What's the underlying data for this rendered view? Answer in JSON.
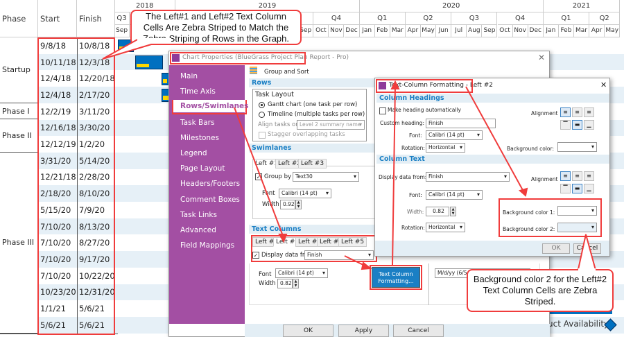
{
  "table": {
    "headers": {
      "phase": "Phase",
      "start": "Start",
      "finish": "Finish"
    },
    "rows": [
      {
        "start": "9/8/18",
        "finish": "10/8/18"
      },
      {
        "start": "10/11/18",
        "finish": "12/3/18"
      },
      {
        "start": "12/4/18",
        "finish": "12/20/18"
      },
      {
        "start": "12/4/18",
        "finish": "2/17/20"
      },
      {
        "start": "12/2/19",
        "finish": "3/11/20"
      },
      {
        "start": "12/16/18",
        "finish": "3/30/20"
      },
      {
        "start": "12/12/19",
        "finish": "1/2/20"
      },
      {
        "start": "3/31/20",
        "finish": "5/14/20"
      },
      {
        "start": "12/21/18",
        "finish": "2/28/20"
      },
      {
        "start": "2/18/20",
        "finish": "8/10/20"
      },
      {
        "start": "5/15/20",
        "finish": "7/9/20"
      },
      {
        "start": "7/10/20",
        "finish": "8/13/20"
      },
      {
        "start": "7/10/20",
        "finish": "8/27/20"
      },
      {
        "start": "7/10/20",
        "finish": "9/17/20"
      },
      {
        "start": "7/10/20",
        "finish": "10/22/20"
      },
      {
        "start": "10/23/20",
        "finish": "12/31/20"
      },
      {
        "start": "1/1/21",
        "finish": "5/6/21"
      },
      {
        "start": "5/6/21",
        "finish": "5/6/21"
      }
    ],
    "phases": [
      "Startup",
      "Phase I",
      "Phase II",
      "Phase III"
    ]
  },
  "timescale": {
    "years": [
      "2018",
      "2019",
      "2020",
      "2021"
    ],
    "quarters": [
      "Q3",
      "Q4",
      "Q1",
      "Q2",
      "Q3",
      "Q4",
      "Q1",
      "Q2",
      "Q3",
      "Q4",
      "Q1",
      "Q2"
    ],
    "months": [
      "Sep",
      "Oct",
      "Nov",
      "Dec",
      "Jan",
      "Feb",
      "Mar",
      "Apr",
      "May",
      "Jun",
      "Jul",
      "Aug",
      "Sep",
      "Oct",
      "Nov",
      "Dec",
      "Jan",
      "Feb",
      "Mar",
      "Apr",
      "May",
      "Jun",
      "Jul",
      "Aug",
      "Sep",
      "Oct",
      "Nov",
      "Dec",
      "Jan",
      "Feb",
      "Mar",
      "Apr",
      "May"
    ]
  },
  "milestone_label": "uct Availability",
  "chart_properties": {
    "title": "Chart Properties (BlueGrass Project Plan Report - Pro)",
    "sidebar": [
      "Main",
      "Time Axis",
      "Rows/Swimlanes",
      "Task Bars",
      "Milestones",
      "Legend",
      "Page Layout",
      "Headers/Footers",
      "Comment Boxes",
      "Task Links",
      "Advanced",
      "Field Mappings"
    ],
    "group_sort": "Group and Sort",
    "rows_header": "Rows",
    "task_layout": "Task Layout",
    "gantt_option": "Gantt chart (one task per row)",
    "timeline_option": "Timeline (multiple tasks per row)",
    "align_label": "Align tasks on",
    "align_value": "Level 2 summary name",
    "stagger": "Stagger overlapping tasks",
    "swimlanes_header": "Swimlanes",
    "swim_tabs": [
      "Left #1",
      "Left #2",
      "Left #3"
    ],
    "group_by": "Group by",
    "group_by_value": "Text30",
    "font_label": "Font",
    "width_label": "Width",
    "swim_font": "Calibri (14 pt)",
    "swim_width": "0.92",
    "text_columns_header": "Text Columns",
    "tc_tabs": [
      "Left #1",
      "Left #2",
      "Left #3",
      "Left #4",
      "Left #5"
    ],
    "display_from": "Display data from",
    "display_value": "Finish",
    "tc_font": "Calibri (14 pt)",
    "tc_width": "0.82",
    "tcf_button": "Text Column Formatting...",
    "date_format": "M/d/yy (6/5/3",
    "ok": "OK",
    "apply": "Apply",
    "cancel": "Cancel"
  },
  "text_col_fmt": {
    "title": "Text-Column Formatting - Left #2",
    "headings_header": "Column Headings",
    "make_heading": "Make heading automatically",
    "custom_heading_label": "Custom heading:",
    "custom_heading": "Finish",
    "font_label": "Font:",
    "font": "Calibri (14 pt)",
    "rotation_label": "Rotation:",
    "rotation": "Horizontal",
    "alignment": "Alignment",
    "bg_color": "Background color:",
    "column_text_header": "Column Text",
    "display_from_label": "Display data from:",
    "display_from": "Finish",
    "font2": "Calibri (14 pt)",
    "width_label": "Width:",
    "width": "0.82",
    "rotation2": "Horizontal",
    "bg1": "Background color 1:",
    "bg2": "Background color 2:",
    "ok": "OK",
    "cancel": "Cancel"
  },
  "callouts": {
    "top": "The Left#1 and Left#2 Text Column Cells Are Zebra Striped to Match the Zebra Striping of Rows in the Graph.",
    "bottom": "Background color 2 for the Left#2 Text Column Cells are Zebra Striped."
  },
  "colors": {
    "stripe": "#e6f0f7",
    "bar": "#0070c0",
    "bar_progress": "#ffd700",
    "accent_red": "#f03c3c",
    "sidebar": "#a34fa3",
    "section": "#1a7fc4"
  }
}
